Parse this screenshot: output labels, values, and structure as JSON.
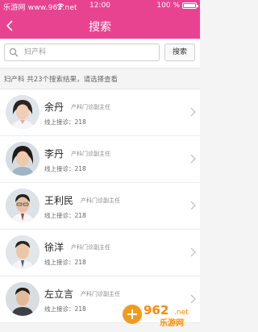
{
  "status": {
    "site": "乐游网 www.962.net",
    "time": "12:00",
    "battery": "100 %",
    "battery_level": 1.0
  },
  "nav": {
    "title": "搜索"
  },
  "search": {
    "value": "",
    "placeholder": "妇产科",
    "button": "搜索"
  },
  "summary": "妇产科 共23个搜索结果，请选择查看",
  "doctors": [
    {
      "name": "余丹",
      "title": "产科门诊副主任",
      "consult": "线上接诊：218"
    },
    {
      "name": "李丹",
      "title": "产科门诊副主任",
      "consult": "线上接诊：218"
    },
    {
      "name": "王利民",
      "title": "产科门诊副主任",
      "consult": "线上接诊：218"
    },
    {
      "name": "徐洋",
      "title": "产科门诊副主任",
      "consult": "线上接诊：218"
    },
    {
      "name": "左立言",
      "title": "产科门诊副主任",
      "consult": "线上接诊：218"
    }
  ],
  "watermark": {
    "logo": "962",
    "suffix": ".net",
    "brand": "乐游网"
  }
}
